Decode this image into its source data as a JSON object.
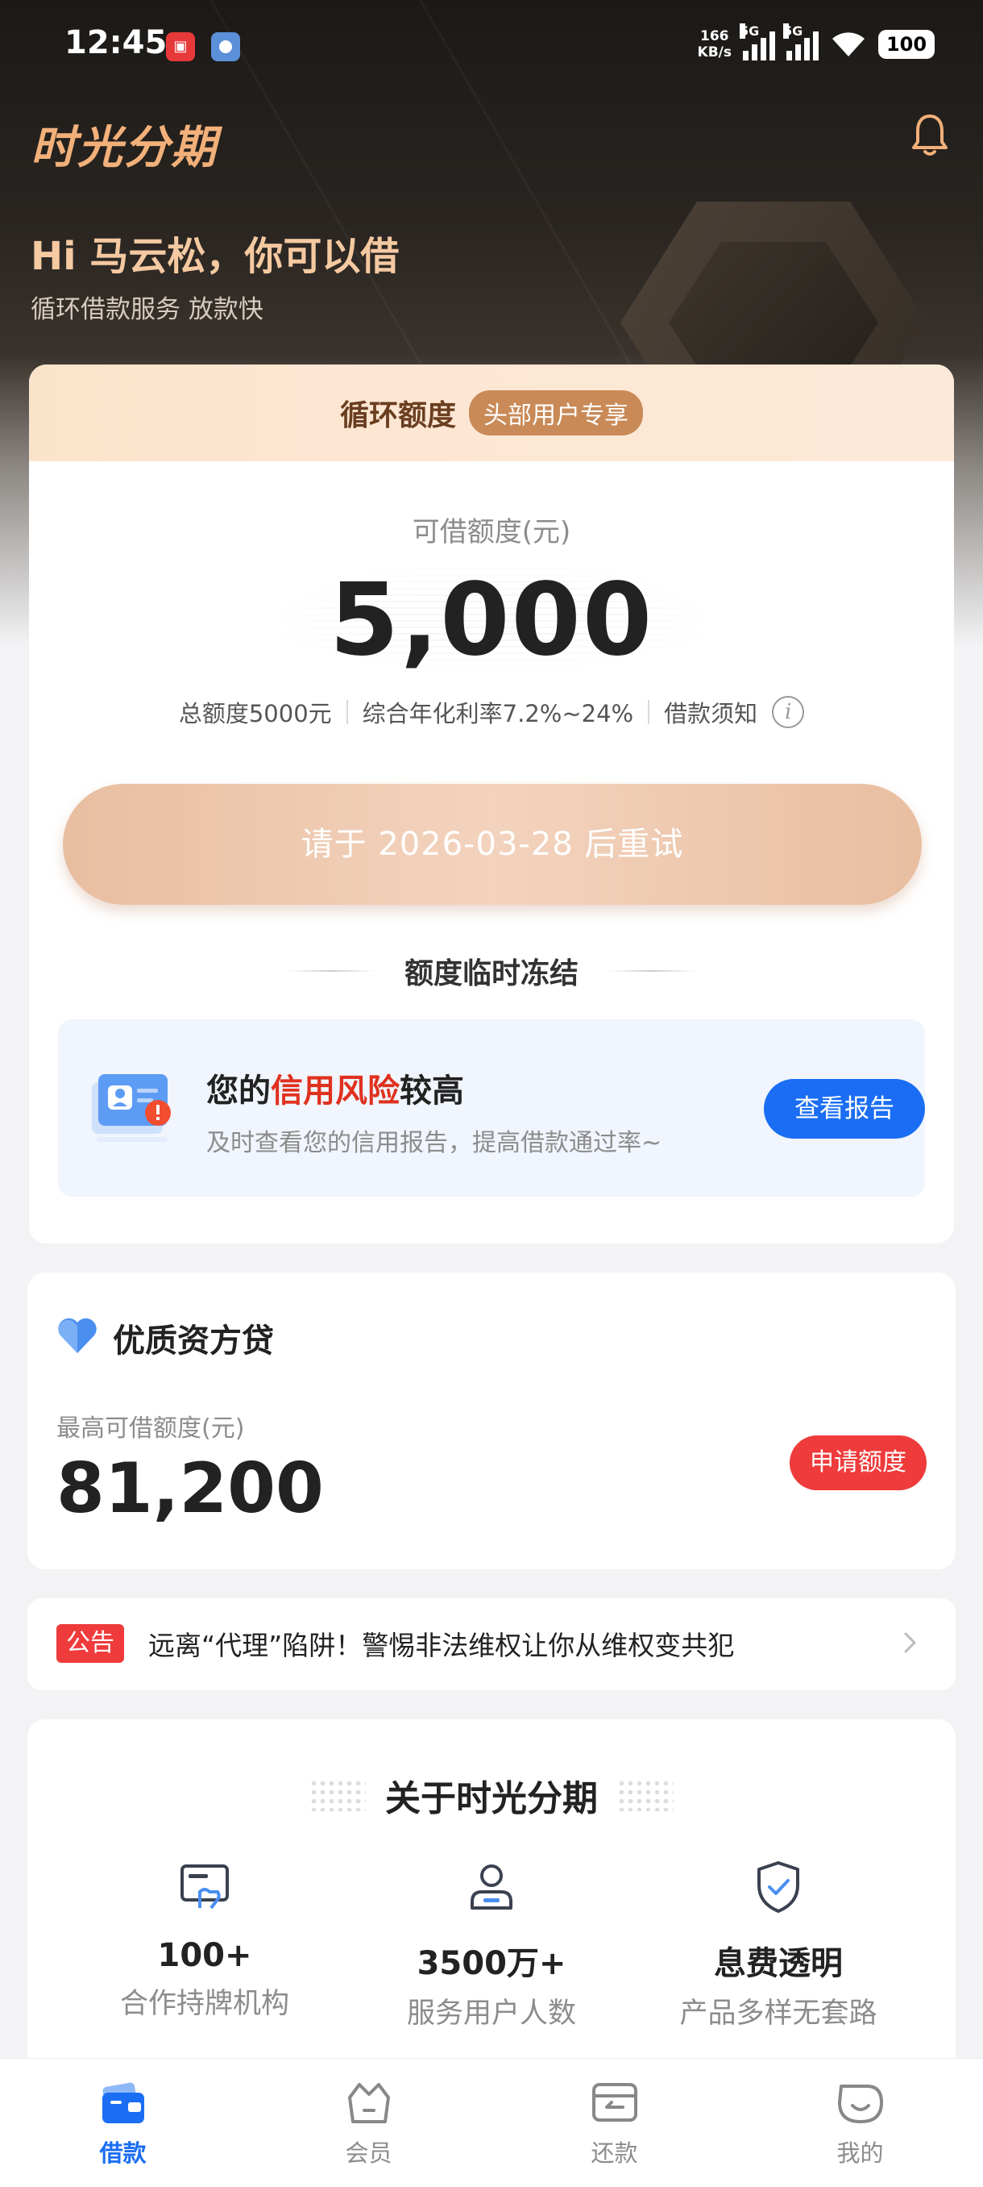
{
  "status_bar": {
    "time": "12:45",
    "net_speed_value": "166",
    "net_speed_unit": "KB/s",
    "signal_1": "5G",
    "signal_2": "5G",
    "battery": "100",
    "app_icon_1": "app-notification-icon",
    "app_icon_2": "app-browser-icon"
  },
  "header": {
    "brand": "时光分期",
    "bell_icon": "bell-icon",
    "greeting": "Hi 马云松，你可以借",
    "subtitle": "循环借款服务 放款快"
  },
  "credit_card": {
    "head_title": "循环额度",
    "head_badge": "头部用户专享",
    "available_label": "可借额度(元)",
    "available_amount": "5,000",
    "total_limit": "总额度5000元",
    "annual_rate": "综合年化利率7.2%~24%",
    "loan_notice": "借款须知",
    "info_icon": "info-icon",
    "retry_button": "请于 2026-03-28 后重试",
    "frozen_text": "额度临时冻结"
  },
  "risk": {
    "title_prefix": "您的",
    "title_highlight": "信用风险",
    "title_suffix": "较高",
    "subtitle": "及时查看您的信用报告，提高借款通过率~",
    "button": "查看报告",
    "highlight_color": "#e0311f"
  },
  "quality_loan": {
    "title": "优质资方贷",
    "max_label": "最高可借额度(元)",
    "max_amount": "81,200",
    "apply_button": "申请额度"
  },
  "notice": {
    "tag": "公告",
    "text": "远离“代理”陷阱！警惕非法维权让你从维权变共犯"
  },
  "about": {
    "title": "关于时光分期",
    "stats": [
      {
        "value": "100+",
        "label": "合作持牌机构",
        "icon": "licensed-institution-icon"
      },
      {
        "value": "3500万+",
        "label": "服务用户人数",
        "icon": "user-service-icon"
      },
      {
        "value": "息费透明",
        "label": "产品多样无套路",
        "icon": "shield-check-icon"
      }
    ]
  },
  "bottom_nav": {
    "items": [
      {
        "label": "借款",
        "icon": "wallet-icon",
        "active": true
      },
      {
        "label": "会员",
        "icon": "member-basket-icon",
        "active": false
      },
      {
        "label": "还款",
        "icon": "repayment-icon",
        "active": false
      },
      {
        "label": "我的",
        "icon": "profile-face-icon",
        "active": false
      }
    ]
  },
  "colors": {
    "accent_blue": "#1b6ef3",
    "alert_red": "#ef3b3b",
    "brand_gold": "#f2b07a"
  }
}
